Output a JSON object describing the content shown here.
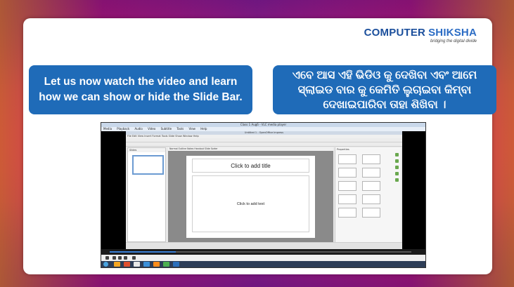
{
  "branding": {
    "name_part1": "COMPUTER",
    "name_part2": "SHIKSHA",
    "tagline": "bridging the digital divide"
  },
  "callouts": {
    "english": "Let us now watch the video and learn how we can show or hide the Slide Bar.",
    "odia": "ଏବେ ଆସ ଏହି ଭିଡିଓ କୁ ଦେଖିବା ଏବଂ ଆମେ ସ୍ଲାଇଡ ବାର କୁ କେମିତି ଲୁଚାଇବା କିମ୍ବା ଦେଖାଇପାରିବା ତାହା ଶିଖିବା ।"
  },
  "video": {
    "vlc_title": "Class 1 Aug6 - VLC media player",
    "vlc_menu": [
      "Media",
      "Playback",
      "Audio",
      "Video",
      "Subtitle",
      "Tools",
      "View",
      "Help"
    ],
    "impress_title": "Untitled 1 - OpenOffice Impress",
    "impress_menu": "File  Edit  View  Insert  Format  Tools  Slide Show  Window  Help",
    "slides_pane_title": "Slides",
    "edit_tabs": "Normal  Outline  Notes  Handout  Slide Sorter",
    "placeholder_title": "Click to add title",
    "placeholder_text": "Click to add text",
    "properties_title": "Properties",
    "progress_fraction": 0.22
  },
  "colors": {
    "callout_bg": "#1f6bb8",
    "brand_dark": "#1b4f9c"
  }
}
